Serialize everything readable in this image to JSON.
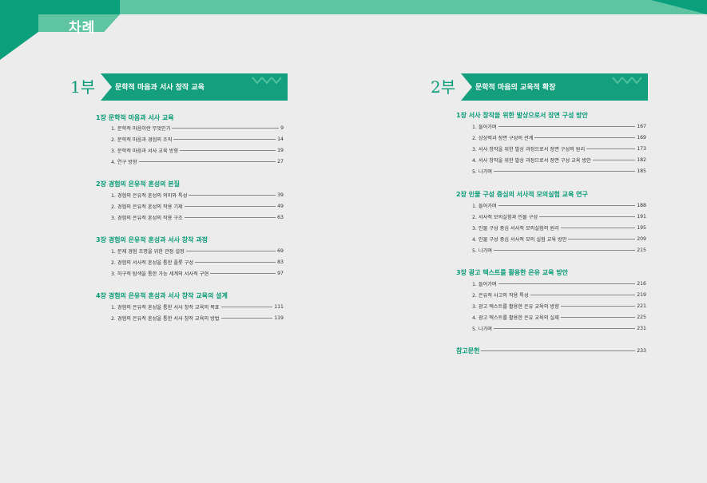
{
  "toc_title": "차례",
  "parts": [
    {
      "num": "1부",
      "title": "문학적 마음과 서사 창작 교육",
      "chapters": [
        {
          "title": "1장  문학적 마음과 서사 교육",
          "entries": [
            {
              "label": "1. 문학적 마음이란 무엇인가",
              "page": "9"
            },
            {
              "label": "2. 문학적 마음과 경험의 조직",
              "page": "14"
            },
            {
              "label": "3. 문학적 마음과 서사 교육 방향",
              "page": "19"
            },
            {
              "label": "4. 연구 방향",
              "page": "27"
            }
          ]
        },
        {
          "title": "2장  경험의 은유적 혼성의 본질",
          "entries": [
            {
              "label": "1. 경험의 은유적 혼성의 의미와 특성",
              "page": "39"
            },
            {
              "label": "2. 경험의 은유적 혼성의 작용 기제",
              "page": "49"
            },
            {
              "label": "3. 경험의 은유적 혼성의 작용 구조",
              "page": "63"
            }
          ]
        },
        {
          "title": "3장  경험의 은유적 혼성과 서사 창작 과정",
          "entries": [
            {
              "label": "1. 문제 경험 조명을 위한 관점 설정",
              "page": "69"
            },
            {
              "label": "2. 경험의 서사적 혼성을 통한 플롯 구성",
              "page": "83"
            },
            {
              "label": "3. 허구적 탐색을 통한 가능 세계의 서사적 구현",
              "page": "97"
            }
          ]
        },
        {
          "title": "4장  경험의 은유적 혼성과 서사 창작 교육의 설계",
          "entries": [
            {
              "label": "1. 경험의 은유적 혼성을 통한 서사 창작 교육의 목표",
              "page": "111"
            },
            {
              "label": "2. 경험의 은유적 혼성을 통한 서사 창작 교육의 방법",
              "page": "119"
            }
          ]
        }
      ]
    },
    {
      "num": "2부",
      "title": "문학적 마음의 교육적 확장",
      "chapters": [
        {
          "title": "1장  서사 창작을 위한 발상으로서 장면 구성 방안",
          "entries": [
            {
              "label": "1. 들어가며",
              "page": "167"
            },
            {
              "label": "2. 상상력과 장면 구성의 관계",
              "page": "169"
            },
            {
              "label": "3. 서사 창작을 위한 발상 과정으로서 장면 구성의 원리",
              "page": "173"
            },
            {
              "label": "4. 서사 창작을 위한 발상 과정으로서 장면 구성 교육 방안",
              "page": "182"
            },
            {
              "label": "5. 나가며",
              "page": "185"
            }
          ]
        },
        {
          "title": "2장  인물 구성 중심의 서사적 모의실험 교육 연구",
          "entries": [
            {
              "label": "1. 들어가며",
              "page": "188"
            },
            {
              "label": "2. 서사적 모의실험과 인물 구성",
              "page": "191"
            },
            {
              "label": "3. 인물 구성 중심 서사적 모의실험의 원리",
              "page": "195"
            },
            {
              "label": "4. 인물 구성 중심 서사적 모의 실험 교육 방안",
              "page": "209"
            },
            {
              "label": "5. 나가며",
              "page": "215"
            }
          ]
        },
        {
          "title": "3장  광고 텍스트를 활용한 은유 교육 방안",
          "entries": [
            {
              "label": "1. 들어가며",
              "page": "216"
            },
            {
              "label": "2. 은유적 사고의 작용 특성",
              "page": "219"
            },
            {
              "label": "3. 광고 텍스트를 활용한 은유 교육의 방향",
              "page": "221"
            },
            {
              "label": "4. 광고 텍스트를 활용한 은유 교육의 실제",
              "page": "225"
            },
            {
              "label": "5. 나가며",
              "page": "231"
            }
          ]
        }
      ]
    }
  ],
  "references": {
    "label": "참고문헌",
    "page": "233"
  },
  "colors": {
    "accent": "#14a07c",
    "light": "#5fc4a2",
    "background": "#ececec"
  }
}
